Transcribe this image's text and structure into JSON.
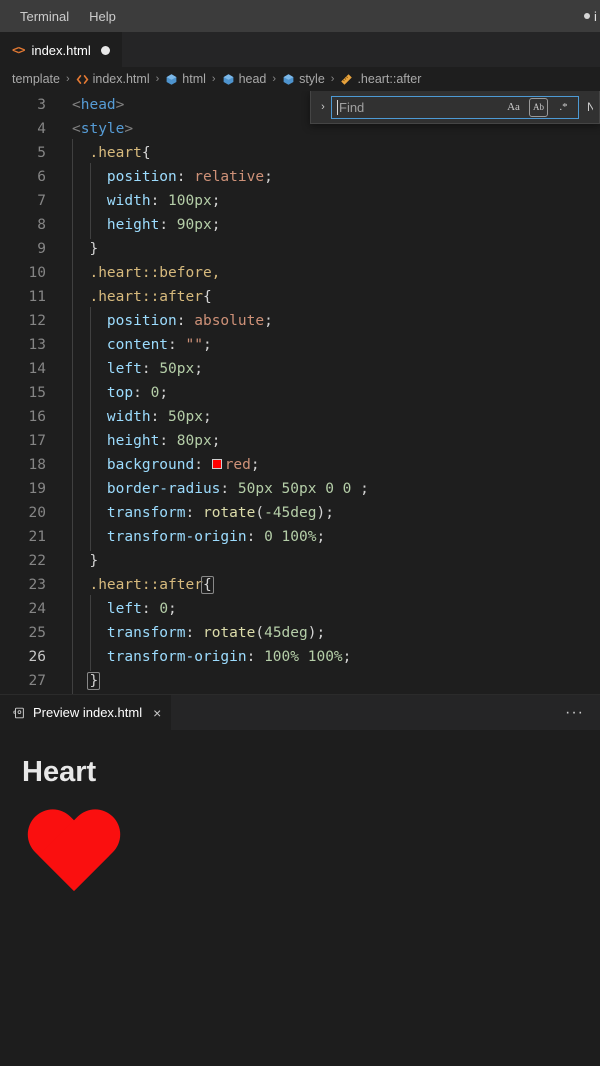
{
  "menubar": {
    "items": [
      {
        "label": "Terminal"
      },
      {
        "label": "Help"
      }
    ],
    "right_cut_text": "i"
  },
  "tabs": [
    {
      "label": "index.html",
      "icon": "html-file-icon",
      "dirty": true
    }
  ],
  "breadcrumb": {
    "items": [
      {
        "label": "template",
        "icon": ""
      },
      {
        "label": "index.html",
        "icon": "html-file-icon"
      },
      {
        "label": "html",
        "icon": "symbol-cube-icon"
      },
      {
        "label": "head",
        "icon": "symbol-cube-icon"
      },
      {
        "label": "style",
        "icon": "symbol-cube-icon"
      },
      {
        "label": ".heart::after",
        "icon": "symbol-ruler-icon"
      }
    ],
    "separator": "›"
  },
  "find_widget": {
    "expand_icon": "›",
    "placeholder": "Find",
    "value": "",
    "options": [
      {
        "name": "match-case",
        "label": "Aa"
      },
      {
        "name": "match-whole-word",
        "label": "Ab"
      },
      {
        "name": "use-regex",
        "label": ".*"
      }
    ],
    "result_count": "No"
  },
  "editor": {
    "active_line": 26,
    "lines": [
      {
        "n": 3,
        "indent": 0,
        "tokens": [
          {
            "c": "punc",
            "t": "<"
          },
          {
            "c": "tag",
            "t": "head"
          },
          {
            "c": "punc",
            "t": ">"
          }
        ]
      },
      {
        "n": 4,
        "indent": 0,
        "tokens": [
          {
            "c": "punc",
            "t": "<"
          },
          {
            "c": "tag",
            "t": "style"
          },
          {
            "c": "punc",
            "t": ">"
          }
        ]
      },
      {
        "n": 5,
        "indent": 1,
        "tokens": [
          {
            "c": "plain",
            "t": "  "
          },
          {
            "c": "sel",
            "t": ".heart"
          },
          {
            "c": "brace",
            "t": "{"
          }
        ]
      },
      {
        "n": 6,
        "indent": 2,
        "tokens": [
          {
            "c": "plain",
            "t": "    "
          },
          {
            "c": "prop",
            "t": "position"
          },
          {
            "c": "plain",
            "t": ": "
          },
          {
            "c": "val",
            "t": "relative"
          },
          {
            "c": "plain",
            "t": ";"
          }
        ]
      },
      {
        "n": 7,
        "indent": 2,
        "tokens": [
          {
            "c": "plain",
            "t": "    "
          },
          {
            "c": "prop",
            "t": "width"
          },
          {
            "c": "plain",
            "t": ": "
          },
          {
            "c": "num",
            "t": "100px"
          },
          {
            "c": "plain",
            "t": ";"
          }
        ]
      },
      {
        "n": 8,
        "indent": 2,
        "tokens": [
          {
            "c": "plain",
            "t": "    "
          },
          {
            "c": "prop",
            "t": "height"
          },
          {
            "c": "plain",
            "t": ": "
          },
          {
            "c": "num",
            "t": "90px"
          },
          {
            "c": "plain",
            "t": ";"
          }
        ]
      },
      {
        "n": 9,
        "indent": 1,
        "tokens": [
          {
            "c": "plain",
            "t": "  "
          },
          {
            "c": "brace",
            "t": "}"
          }
        ]
      },
      {
        "n": 10,
        "indent": 1,
        "tokens": [
          {
            "c": "plain",
            "t": "  "
          },
          {
            "c": "sel",
            "t": ".heart::before,"
          }
        ]
      },
      {
        "n": 11,
        "indent": 1,
        "tokens": [
          {
            "c": "plain",
            "t": "  "
          },
          {
            "c": "sel",
            "t": ".heart::after"
          },
          {
            "c": "brace",
            "t": "{"
          }
        ]
      },
      {
        "n": 12,
        "indent": 2,
        "tokens": [
          {
            "c": "plain",
            "t": "    "
          },
          {
            "c": "prop",
            "t": "position"
          },
          {
            "c": "plain",
            "t": ": "
          },
          {
            "c": "val",
            "t": "absolute"
          },
          {
            "c": "plain",
            "t": ";"
          }
        ]
      },
      {
        "n": 13,
        "indent": 2,
        "tokens": [
          {
            "c": "plain",
            "t": "    "
          },
          {
            "c": "prop",
            "t": "content"
          },
          {
            "c": "plain",
            "t": ": "
          },
          {
            "c": "val",
            "t": "\"\""
          },
          {
            "c": "plain",
            "t": ";"
          }
        ]
      },
      {
        "n": 14,
        "indent": 2,
        "tokens": [
          {
            "c": "plain",
            "t": "    "
          },
          {
            "c": "prop",
            "t": "left"
          },
          {
            "c": "plain",
            "t": ": "
          },
          {
            "c": "num",
            "t": "50px"
          },
          {
            "c": "plain",
            "t": ";"
          }
        ]
      },
      {
        "n": 15,
        "indent": 2,
        "tokens": [
          {
            "c": "plain",
            "t": "    "
          },
          {
            "c": "prop",
            "t": "top"
          },
          {
            "c": "plain",
            "t": ": "
          },
          {
            "c": "num",
            "t": "0"
          },
          {
            "c": "plain",
            "t": ";"
          }
        ]
      },
      {
        "n": 16,
        "indent": 2,
        "tokens": [
          {
            "c": "plain",
            "t": "    "
          },
          {
            "c": "prop",
            "t": "width"
          },
          {
            "c": "plain",
            "t": ": "
          },
          {
            "c": "num",
            "t": "50px"
          },
          {
            "c": "plain",
            "t": ";"
          }
        ]
      },
      {
        "n": 17,
        "indent": 2,
        "tokens": [
          {
            "c": "plain",
            "t": "    "
          },
          {
            "c": "prop",
            "t": "height"
          },
          {
            "c": "plain",
            "t": ": "
          },
          {
            "c": "num",
            "t": "80px"
          },
          {
            "c": "plain",
            "t": ";"
          }
        ]
      },
      {
        "n": 18,
        "indent": 2,
        "swatch": "#ff0000",
        "tokens": [
          {
            "c": "plain",
            "t": "    "
          },
          {
            "c": "prop",
            "t": "background"
          },
          {
            "c": "plain",
            "t": ": "
          },
          {
            "c": "swatch",
            "t": ""
          },
          {
            "c": "val",
            "t": "red"
          },
          {
            "c": "plain",
            "t": ";"
          }
        ]
      },
      {
        "n": 19,
        "indent": 2,
        "tokens": [
          {
            "c": "plain",
            "t": "    "
          },
          {
            "c": "prop",
            "t": "border-radius"
          },
          {
            "c": "plain",
            "t": ": "
          },
          {
            "c": "num",
            "t": "50px"
          },
          {
            "c": "plain",
            "t": " "
          },
          {
            "c": "num",
            "t": "50px"
          },
          {
            "c": "plain",
            "t": " "
          },
          {
            "c": "num",
            "t": "0"
          },
          {
            "c": "plain",
            "t": " "
          },
          {
            "c": "num",
            "t": "0"
          },
          {
            "c": "plain",
            "t": " ;"
          }
        ]
      },
      {
        "n": 20,
        "indent": 2,
        "tokens": [
          {
            "c": "plain",
            "t": "    "
          },
          {
            "c": "prop",
            "t": "transform"
          },
          {
            "c": "plain",
            "t": ": "
          },
          {
            "c": "func",
            "t": "rotate"
          },
          {
            "c": "plain",
            "t": "("
          },
          {
            "c": "num",
            "t": "-45deg"
          },
          {
            "c": "plain",
            "t": ");"
          }
        ]
      },
      {
        "n": 21,
        "indent": 2,
        "tokens": [
          {
            "c": "plain",
            "t": "    "
          },
          {
            "c": "prop",
            "t": "transform-origin"
          },
          {
            "c": "plain",
            "t": ": "
          },
          {
            "c": "num",
            "t": "0"
          },
          {
            "c": "plain",
            "t": " "
          },
          {
            "c": "num",
            "t": "100%"
          },
          {
            "c": "plain",
            "t": ";"
          }
        ]
      },
      {
        "n": 22,
        "indent": 1,
        "tokens": [
          {
            "c": "plain",
            "t": "  "
          },
          {
            "c": "brace",
            "t": "}"
          }
        ]
      },
      {
        "n": 23,
        "indent": 1,
        "tokens": [
          {
            "c": "plain",
            "t": "  "
          },
          {
            "c": "sel",
            "t": ".heart::after"
          },
          {
            "c": "brace-match",
            "t": "{"
          }
        ]
      },
      {
        "n": 24,
        "indent": 2,
        "tokens": [
          {
            "c": "plain",
            "t": "    "
          },
          {
            "c": "prop",
            "t": "left"
          },
          {
            "c": "plain",
            "t": ": "
          },
          {
            "c": "num",
            "t": "0"
          },
          {
            "c": "plain",
            "t": ";"
          }
        ]
      },
      {
        "n": 25,
        "indent": 2,
        "tokens": [
          {
            "c": "plain",
            "t": "    "
          },
          {
            "c": "prop",
            "t": "transform"
          },
          {
            "c": "plain",
            "t": ": "
          },
          {
            "c": "func",
            "t": "rotate"
          },
          {
            "c": "plain",
            "t": "("
          },
          {
            "c": "num",
            "t": "45deg"
          },
          {
            "c": "plain",
            "t": ");"
          }
        ]
      },
      {
        "n": 26,
        "indent": 2,
        "tokens": [
          {
            "c": "plain",
            "t": "    "
          },
          {
            "c": "prop",
            "t": "transform-origin"
          },
          {
            "c": "plain",
            "t": ": "
          },
          {
            "c": "num",
            "t": "100%"
          },
          {
            "c": "plain",
            "t": " "
          },
          {
            "c": "num",
            "t": "100%"
          },
          {
            "c": "plain",
            "t": ";"
          }
        ]
      },
      {
        "n": 27,
        "indent": 1,
        "tokens": [
          {
            "c": "plain",
            "t": "  "
          },
          {
            "c": "brace-match",
            "t": "}"
          }
        ]
      }
    ]
  },
  "preview_panel": {
    "tab": {
      "label": "Preview index.html",
      "icon": "preview-icon",
      "close_icon": "×"
    },
    "more_actions": "···",
    "content": {
      "heading": "Heart",
      "heart_color": "#fa0f0f"
    }
  }
}
